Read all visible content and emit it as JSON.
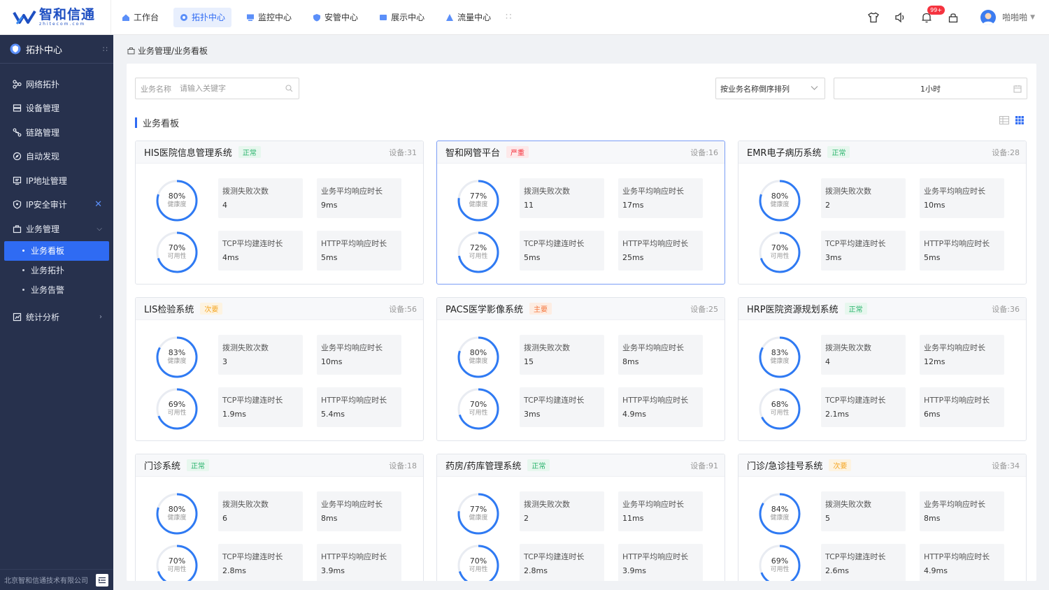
{
  "brand": {
    "name": "智和信通",
    "sub": "zhitecom.com"
  },
  "topnav": [
    {
      "label": "工作台",
      "icon": "home-icon",
      "active": false
    },
    {
      "label": "拓扑中心",
      "icon": "topology-icon",
      "active": true
    },
    {
      "label": "监控中心",
      "icon": "monitor-icon",
      "active": false
    },
    {
      "label": "安管中心",
      "icon": "shield-icon",
      "active": false
    },
    {
      "label": "展示中心",
      "icon": "display-icon",
      "active": false
    },
    {
      "label": "流量中心",
      "icon": "traffic-icon",
      "active": false
    }
  ],
  "header": {
    "notification_count": "99+",
    "user_name": "啪啪啪"
  },
  "sidebar": {
    "title": "拓扑中心",
    "items": [
      {
        "label": "网络拓扑",
        "icon": "network-icon"
      },
      {
        "label": "设备管理",
        "icon": "device-icon"
      },
      {
        "label": "链路管理",
        "icon": "link-icon"
      },
      {
        "label": "自动发现",
        "icon": "discover-icon"
      },
      {
        "label": "IP地址管理",
        "icon": "ip-icon"
      },
      {
        "label": "IP安全审计",
        "icon": "audit-icon"
      },
      {
        "label": "业务管理",
        "icon": "business-icon"
      }
    ],
    "sub_items": [
      {
        "label": "业务看板",
        "active": true
      },
      {
        "label": "业务拓扑",
        "active": false
      },
      {
        "label": "业务告警",
        "active": false
      }
    ],
    "stats_label": "统计分析",
    "footer": "北京智和信通技术有限公司"
  },
  "breadcrumb": "业务管理/业务看板",
  "search": {
    "label": "业务名称",
    "placeholder": "请输入关键字"
  },
  "sort": {
    "value": "按业务名称倒序排列"
  },
  "time": {
    "value": "1小时"
  },
  "section_title": "业务看板",
  "metric_labels": {
    "fail": "拨测失败次数",
    "resp": "业务平均响应时长",
    "tcp": "TCP平均建连时长",
    "http": "HTTP平均响应时长",
    "health": "健康度",
    "avail": "可用性"
  },
  "cards": [
    {
      "title": "HIS医院信息管理系统",
      "status": "正常",
      "status_type": "ok",
      "devices": "设备:31",
      "health": 80,
      "health_text": "80%",
      "avail": 70,
      "avail_text": "70%",
      "fail": "4",
      "resp": "9ms",
      "tcp": "4ms",
      "http": "5ms",
      "selected": false
    },
    {
      "title": "智和网管平台",
      "status": "严重",
      "status_type": "bad",
      "devices": "设备:16",
      "health": 77,
      "health_text": "77%",
      "avail": 72,
      "avail_text": "72%",
      "fail": "11",
      "resp": "17ms",
      "tcp": "5ms",
      "http": "25ms",
      "selected": true
    },
    {
      "title": "EMR电子病历系统",
      "status": "正常",
      "status_type": "ok",
      "devices": "设备:28",
      "health": 80,
      "health_text": "80%",
      "avail": 70,
      "avail_text": "70%",
      "fail": "2",
      "resp": "10ms",
      "tcp": "3ms",
      "http": "5ms",
      "selected": false
    },
    {
      "title": "LIS检验系统",
      "status": "次要",
      "status_type": "warn",
      "devices": "设备:56",
      "health": 83,
      "health_text": "83%",
      "avail": 69,
      "avail_text": "69%",
      "fail": "3",
      "resp": "10ms",
      "tcp": "1.9ms",
      "http": "5.4ms",
      "selected": false
    },
    {
      "title": "PACS医学影像系统",
      "status": "主要",
      "status_type": "major",
      "devices": "设备:25",
      "health": 80,
      "health_text": "80%",
      "avail": 70,
      "avail_text": "70%",
      "fail": "15",
      "resp": "8ms",
      "tcp": "3ms",
      "http": "4.9ms",
      "selected": false
    },
    {
      "title": "HRP医院资源规划系统",
      "status": "正常",
      "status_type": "ok",
      "devices": "设备:36",
      "health": 83,
      "health_text": "83%",
      "avail": 68,
      "avail_text": "68%",
      "fail": "4",
      "resp": "12ms",
      "tcp": "2.1ms",
      "http": "6ms",
      "selected": false
    },
    {
      "title": "门诊系统",
      "status": "正常",
      "status_type": "ok",
      "devices": "设备:18",
      "health": 80,
      "health_text": "80%",
      "avail": 70,
      "avail_text": "70%",
      "fail": "6",
      "resp": "8ms",
      "tcp": "2.8ms",
      "http": "3.9ms",
      "selected": false
    },
    {
      "title": "药房/药库管理系统",
      "status": "正常",
      "status_type": "ok",
      "devices": "设备:91",
      "health": 77,
      "health_text": "77%",
      "avail": 70,
      "avail_text": "70%",
      "fail": "2",
      "resp": "11ms",
      "tcp": "2.8ms",
      "http": "3.9ms",
      "selected": false
    },
    {
      "title": "门诊/急诊挂号系统",
      "status": "次要",
      "status_type": "warn",
      "devices": "设备:34",
      "health": 84,
      "health_text": "84%",
      "avail": 69,
      "avail_text": "69%",
      "fail": "5",
      "resp": "8ms",
      "tcp": "2.6ms",
      "http": "4.9ms",
      "selected": false
    }
  ],
  "colors": {
    "accent": "#2f6bf3",
    "gauge": "#2f7af3",
    "gauge_track": "#e9ecf2",
    "sidebar_bg": "#27314d"
  }
}
